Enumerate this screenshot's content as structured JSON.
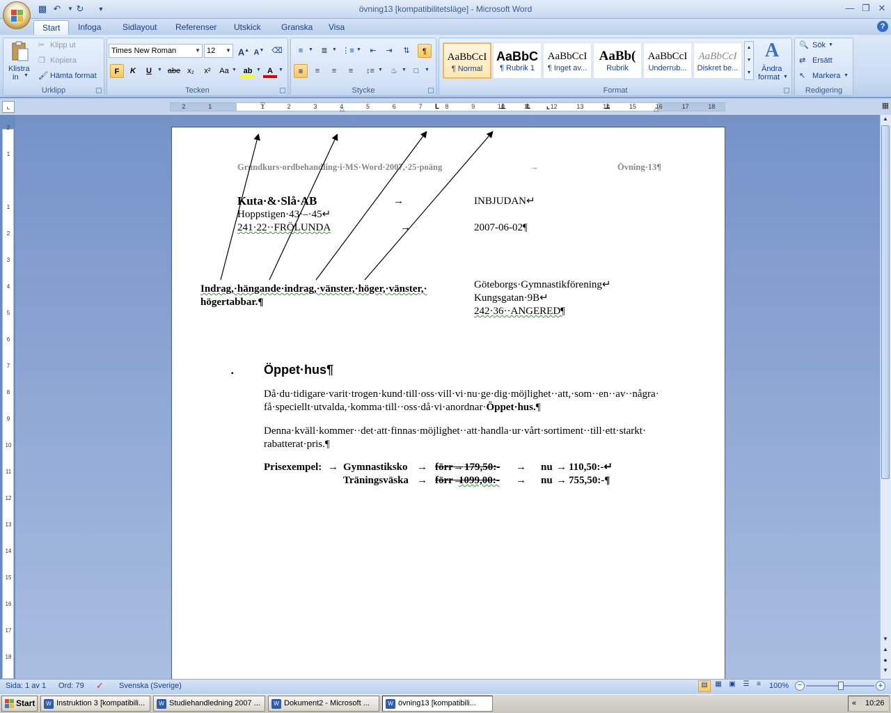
{
  "window": {
    "title": "övning13 [kompatibilitetsläge] - Microsoft Word"
  },
  "quick_access": {
    "icons": [
      "save-icon",
      "undo-icon",
      "redo-icon",
      "customize-icon"
    ]
  },
  "tabs": [
    {
      "label": "Start",
      "active": true
    },
    {
      "label": "Infoga"
    },
    {
      "label": "Sidlayout"
    },
    {
      "label": "Referenser"
    },
    {
      "label": "Utskick"
    },
    {
      "label": "Granska"
    },
    {
      "label": "Visa"
    }
  ],
  "ribbon": {
    "clipboard": {
      "label": "Urklipp",
      "paste_label": "Klistra",
      "paste_sub": "in",
      "cut": "Klipp ut",
      "copy": "Kopiera",
      "format_painter": "Hämta format"
    },
    "font": {
      "label": "Tecken",
      "font_name": "Times New Roman",
      "font_size": "12",
      "bold": "F",
      "italic": "K",
      "underline": "U",
      "strike": "abe",
      "subscript": "x₂",
      "superscript": "x²",
      "change_case": "Aa"
    },
    "paragraph": {
      "label": "Stycke"
    },
    "styles": {
      "label": "Format",
      "items": [
        {
          "sample": "AaBbCcI",
          "name": "¶ Normal",
          "selected": true
        },
        {
          "sample": "AaBbC",
          "name": "¶ Rubrik 1"
        },
        {
          "sample": "AaBbCcI",
          "name": "¶ Inget av..."
        },
        {
          "sample": "AaBb(",
          "name": "Rubrik"
        },
        {
          "sample": "AaBbCcI",
          "name": "Underrub..."
        },
        {
          "sample": "AaBbCcI",
          "name": "Diskret be..."
        }
      ],
      "change_styles": "Ändra",
      "change_styles_sub": "format"
    },
    "editing": {
      "label": "Redigering",
      "find": "Sök",
      "replace": "Ersätt",
      "select": "Markera"
    }
  },
  "ruler": {
    "h_numbers": [
      "2",
      "1",
      "1",
      "2",
      "3",
      "4",
      "5",
      "6",
      "7",
      "8",
      "9",
      "10",
      "11",
      "12",
      "13",
      "14",
      "15",
      "16",
      "17",
      "18"
    ],
    "v_numbers": [
      "2",
      "1",
      "1",
      "2",
      "3",
      "4",
      "5",
      "6",
      "7",
      "8",
      "9",
      "10",
      "11",
      "12",
      "13",
      "14",
      "15",
      "16",
      "17",
      "18"
    ]
  },
  "document": {
    "header_left": "Grundkurs·ordbehandling·i·MS·Word·2007,·25·poäng",
    "header_tab": "→",
    "header_right": "Övning·13¶",
    "company": "Kuta·&·Slå·AB",
    "company_tab": "→",
    "invite": "INBJUDAN↵",
    "address1": "Hoppstigen·43·–·45↵",
    "address2_a": "241·22",
    "address2_b": "··FRÖLUNDA",
    "address2_tab": "→",
    "date": "2007-06-02¶",
    "note_line1": "Indrag,·hängande·indrag,·vänster,·höger,·vänster,·",
    "note_line2": "högertabbar.¶",
    "recipient1": "Göteborgs·Gymnastikförening↵",
    "recipient2": "Kungsgatan·9B↵",
    "recipient3": "242·36··ANGERED¶",
    "bullet": "▪",
    "heading": "Öppet·hus¶",
    "para1_line1": "Då·du·tidigare·varit·trogen·kund·till·oss·vill·vi·nu·ge·dig·möjlighet··att,·som··en··av··några·",
    "para1_line2": "få·speciellt·utvalda,·komma·till··oss·då·vi·anordnar·",
    "para1_bold": "Öppet·hus.",
    "para1_end": "¶",
    "para2_line1": "Denna·kväll·kommer··det·att·finnas·möjlighet··att·handla·ur·vårt·sortiment··till·ett·starkt·",
    "para2_line2": "rabatterat·pris.¶",
    "price_label": "Prisexempel:",
    "tab": "→",
    "item1": "Gymnastiksko",
    "item2": "Träningsväska",
    "before_label": "förr",
    "price1_old": "179,50:-",
    "price2_old": "1099,00:-",
    "now_label": "nu",
    "price1_new": "110,50:-↵",
    "price2_new": "755,50:-¶"
  },
  "status": {
    "page": "Sida: 1 av 1",
    "words": "Ord: 79",
    "language": "Svenska (Sverige)",
    "zoom": "100%"
  },
  "taskbar": {
    "start": "Start",
    "tasks": [
      {
        "label": "Instruktion 3 [kompatibili..."
      },
      {
        "label": "Studiehandledning 2007 ..."
      },
      {
        "label": "Dokument2 - Microsoft ..."
      },
      {
        "label": "övning13 [kompatibili...",
        "active": true
      }
    ],
    "clock": "10:26",
    "tray_expand": "«"
  }
}
